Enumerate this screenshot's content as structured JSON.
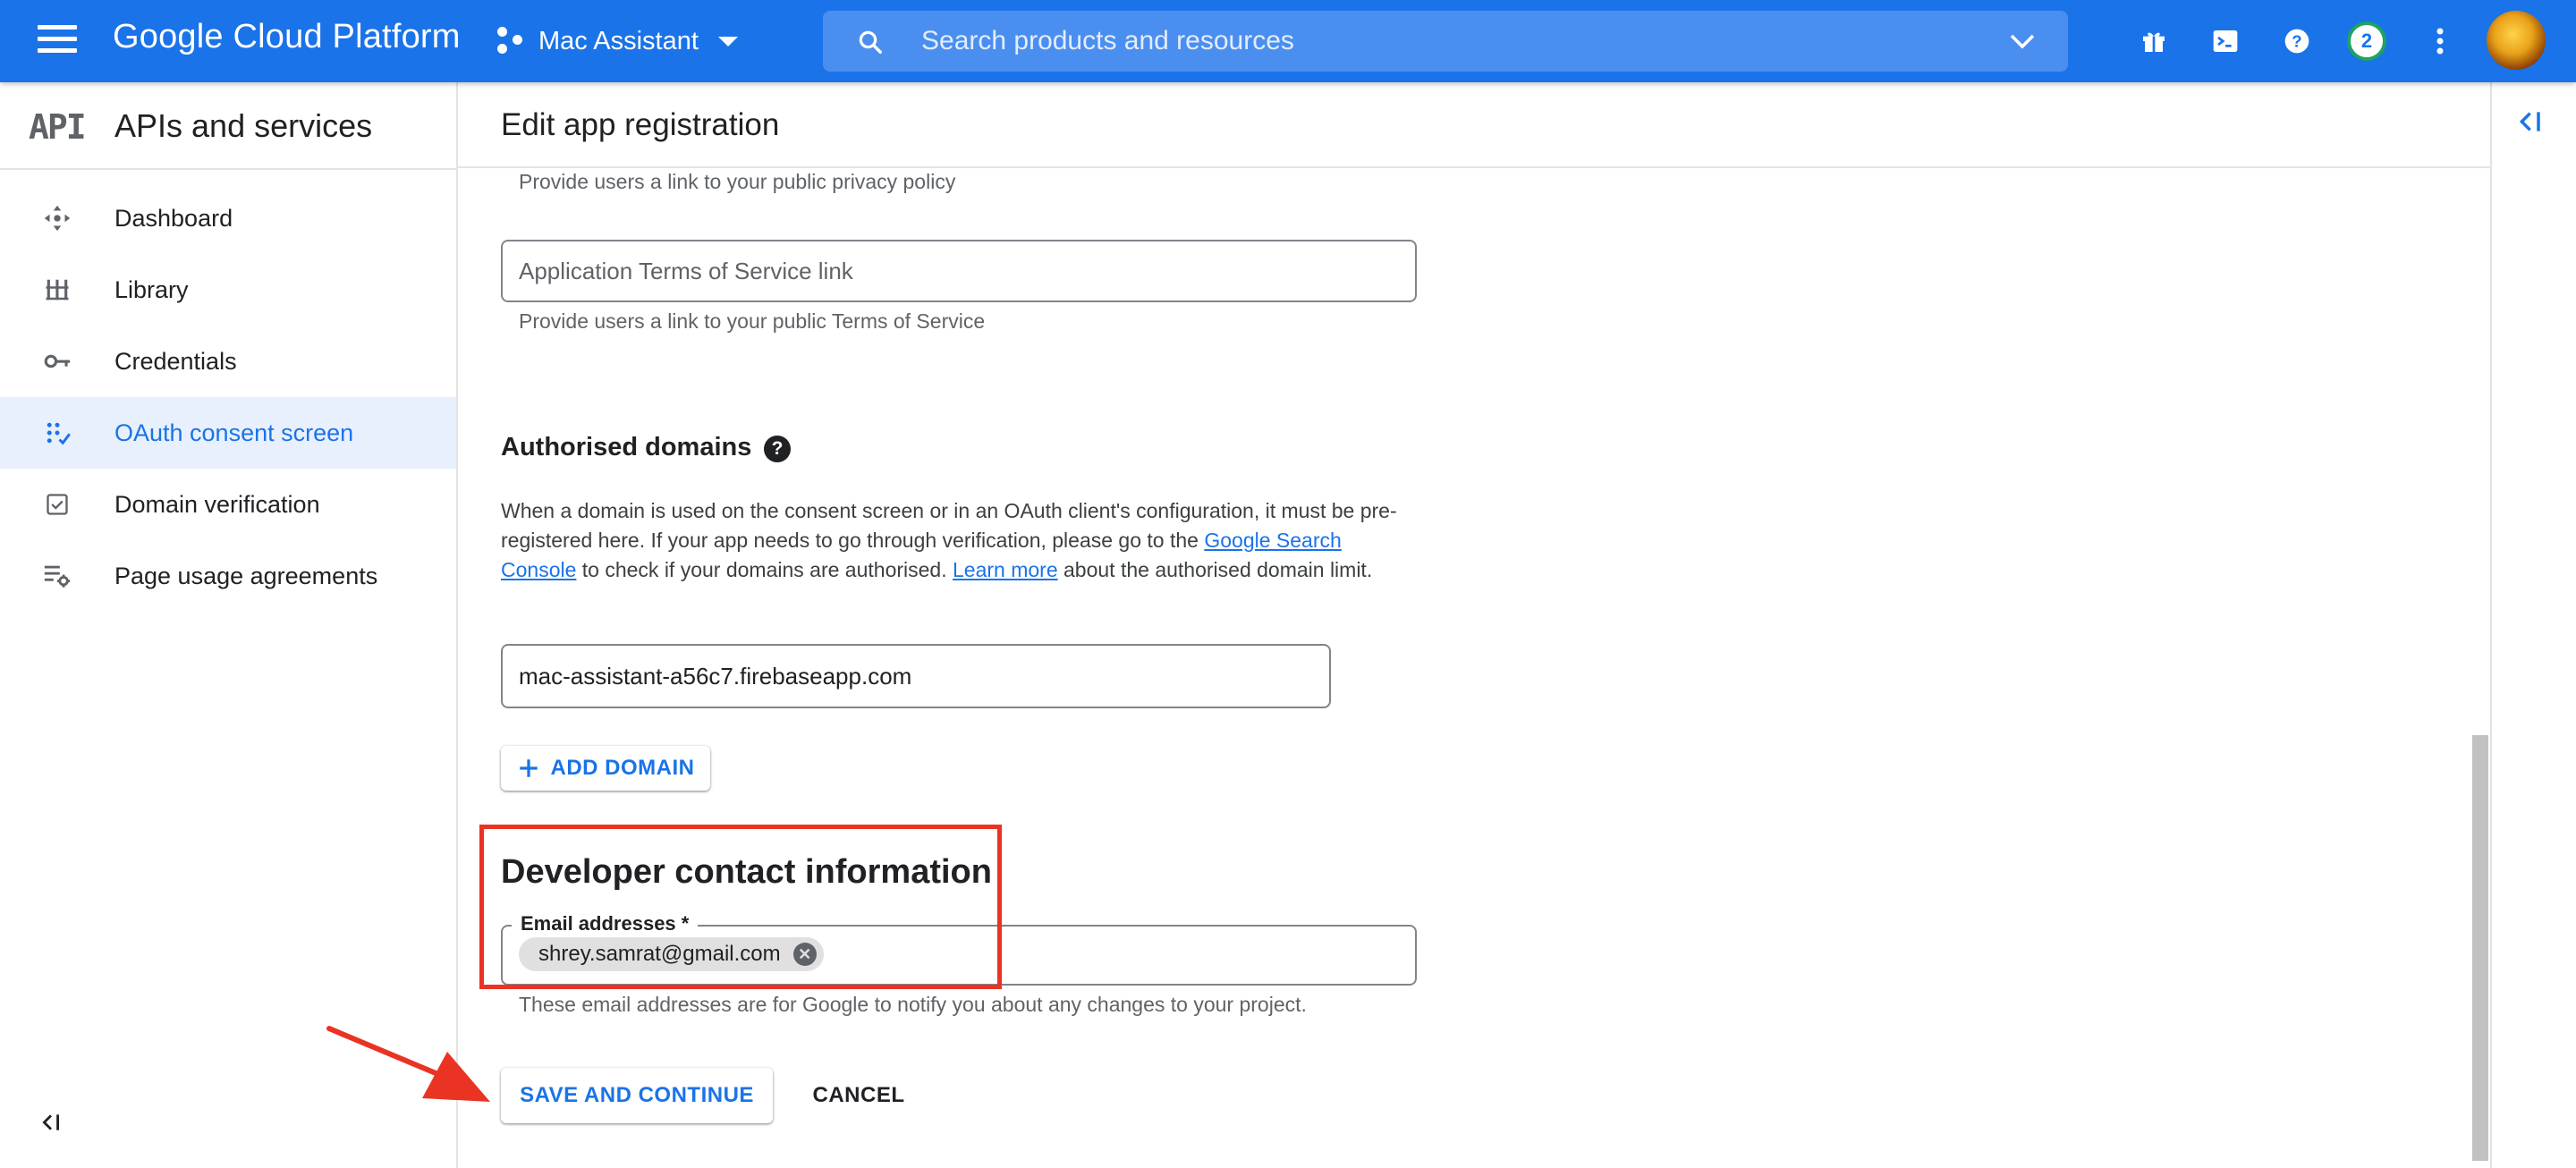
{
  "topbar": {
    "brand": "Google Cloud Platform",
    "project_name": "Mac Assistant",
    "search_placeholder": "Search products and resources",
    "notification_count": "2",
    "accent_color": "#1a73e8"
  },
  "sidebar": {
    "logo_text": "API",
    "title": "APIs and services",
    "items": [
      {
        "label": "Dashboard",
        "icon": "dashboard-icon",
        "active": false
      },
      {
        "label": "Library",
        "icon": "library-icon",
        "active": false
      },
      {
        "label": "Credentials",
        "icon": "key-icon",
        "active": false
      },
      {
        "label": "OAuth consent screen",
        "icon": "oauth-icon",
        "active": true
      },
      {
        "label": "Domain verification",
        "icon": "checkbox-icon",
        "active": false
      },
      {
        "label": "Page usage agreements",
        "icon": "settings-list-icon",
        "active": false
      }
    ]
  },
  "main": {
    "title": "Edit app registration",
    "privacy_hint": "Provide users a link to your public privacy policy",
    "tos_placeholder": "Application Terms of Service link",
    "tos_hint": "Provide users a link to your public Terms of Service",
    "authorised_domains": {
      "title": "Authorised domains",
      "help": "?",
      "text_1": "When a domain is used on the consent screen or in an OAuth client's configuration, it must be pre-registered here. If your app needs to go through verification, please go to the ",
      "link_search_console": "Google Search Console",
      "text_2": " to check if your domains are authorised. ",
      "link_learn_more": "Learn more",
      "text_3": " about the authorised domain limit.",
      "domain_value": "mac-assistant-a56c7.firebaseapp.com",
      "add_domain_label": "ADD DOMAIN"
    },
    "developer_contact": {
      "title": "Developer contact information",
      "email_label": "Email addresses *",
      "email_chip": "shrey.samrat@gmail.com",
      "hint": "These email addresses are for Google to notify you about any changes to your project."
    },
    "save_label": "SAVE AND CONTINUE",
    "cancel_label": "CANCEL"
  }
}
